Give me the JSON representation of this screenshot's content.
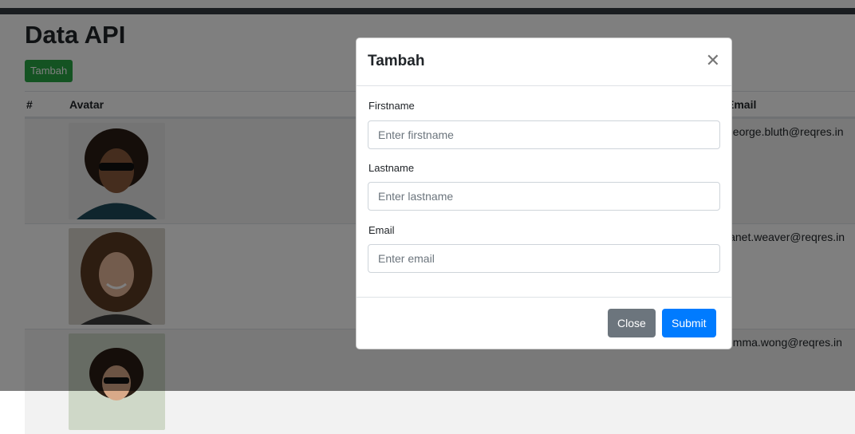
{
  "page": {
    "title": "Data API",
    "add_button_label": "Tambah"
  },
  "table": {
    "columns": [
      "#",
      "Avatar",
      "Email"
    ],
    "rows": [
      {
        "email": "george.bluth@reqres.in"
      },
      {
        "email": "janet.weaver@reqres.in"
      },
      {
        "email": "emma.wong@reqres.in"
      }
    ]
  },
  "modal": {
    "title": "Tambah",
    "close_icon": "close-icon",
    "fields": [
      {
        "label": "Firstname",
        "placeholder": "Enter firstname"
      },
      {
        "label": "Lastname",
        "placeholder": "Enter lastname"
      },
      {
        "label": "Email",
        "placeholder": "Enter email"
      }
    ],
    "close_button_label": "Close",
    "submit_button_label": "Submit"
  },
  "colors": {
    "success": "#28a745",
    "primary": "#007bff",
    "secondary": "#6c757d",
    "navbar": "#343a40"
  }
}
